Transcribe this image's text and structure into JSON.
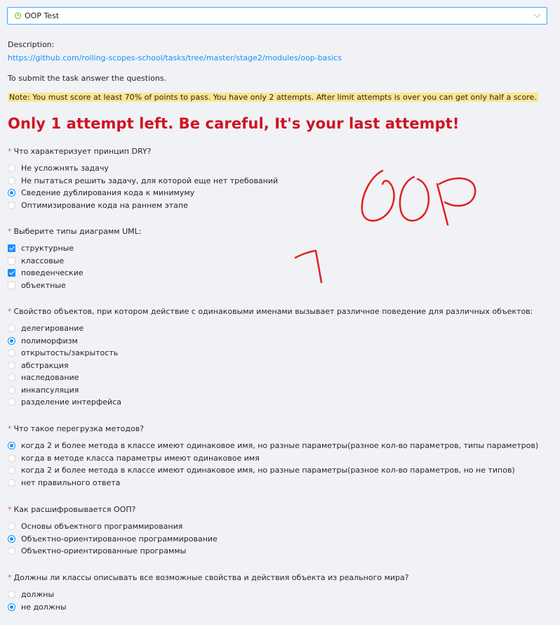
{
  "select": {
    "value": "OOP Test",
    "icon": "clock-icon"
  },
  "description": {
    "label": "Description:",
    "link": "https://github.com/rolling-scopes-school/tasks/tree/master/stage2/modules/oop-basics"
  },
  "submit_text": "To submit the task answer the questions.",
  "note": "Note: You must score at least 70% of points to pass. You have only 2 attempts. After limit attempts is over you can get only half a score.",
  "warning": "Only 1 attempt left. Be careful, It's your last attempt!",
  "colors": {
    "accent": "#1890ff",
    "warning": "#cf1322",
    "note_bg": "#ffe58f",
    "required": "#ff4d4f",
    "scribble": "#e02020"
  },
  "questions": [
    {
      "title": "Что характеризует принцип DRY?",
      "type": "radio",
      "options": [
        {
          "label": "Не усложнять задачу",
          "checked": false
        },
        {
          "label": "Не пытаться решить задачу, для которой еще нет требований",
          "checked": false
        },
        {
          "label": "Сведение дублирования кода к минимуму",
          "checked": true
        },
        {
          "label": "Оптимизирование кода на раннем этапе",
          "checked": false
        }
      ]
    },
    {
      "title": "Выберите типы диаграмм UML:",
      "type": "checkbox",
      "options": [
        {
          "label": "структурные",
          "checked": true
        },
        {
          "label": "классовые",
          "checked": false
        },
        {
          "label": "поведенческие",
          "checked": true
        },
        {
          "label": "объектные",
          "checked": false
        }
      ]
    },
    {
      "title": "Свойство объектов, при котором действие с одинаковыми именами вызывает различное поведение для различных объектов:",
      "type": "radio",
      "options": [
        {
          "label": "делегирование",
          "checked": false
        },
        {
          "label": "полиморфизм",
          "checked": true
        },
        {
          "label": "открытость/закрытость",
          "checked": false
        },
        {
          "label": "абстракция",
          "checked": false
        },
        {
          "label": "наследование",
          "checked": false
        },
        {
          "label": "инкапсуляция",
          "checked": false
        },
        {
          "label": "разделение интерфейса",
          "checked": false
        }
      ]
    },
    {
      "title": "Что такое перегрузка методов?",
      "type": "radio",
      "options": [
        {
          "label": "когда 2 и более метода в классе имеют одинаковое имя, но разные параметры(разное кол-во параметров, типы параметров)",
          "checked": true
        },
        {
          "label": "когда в методе класса параметры имеют одинаковое имя",
          "checked": false
        },
        {
          "label": "когда 2 и более метода в классе имеют одинаковое имя, но разные параметры(разное кол-во параметров, но не типов)",
          "checked": false
        },
        {
          "label": "нет правильного ответа",
          "checked": false
        }
      ]
    },
    {
      "title": "Как расшифровывается ООП?",
      "type": "radio",
      "options": [
        {
          "label": "Основы объектного программирования",
          "checked": false
        },
        {
          "label": "Объектно-ориентированное программирование",
          "checked": true
        },
        {
          "label": "Объектно-ориентированные программы",
          "checked": false
        }
      ]
    },
    {
      "title": "Должны ли классы описывать все возможные свойства и действия объекта из реального мира?",
      "type": "radio",
      "options": [
        {
          "label": "должны",
          "checked": false
        },
        {
          "label": "не должны",
          "checked": true
        }
      ]
    }
  ],
  "annotation": {
    "text": "OOP",
    "number": "1"
  }
}
